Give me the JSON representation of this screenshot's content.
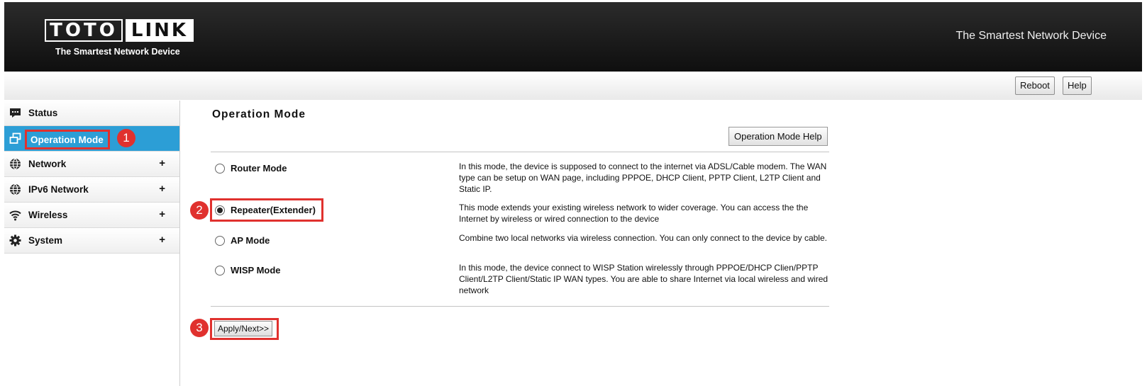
{
  "header": {
    "logo_part1": "TOTO",
    "logo_part2": "LINK",
    "logo_tagline": "The Smartest Network Device",
    "slogan": "The Smartest Network Device"
  },
  "topbar": {
    "reboot_label": "Reboot",
    "help_label": "Help"
  },
  "sidebar": {
    "items": [
      {
        "label": "Status",
        "icon": "chat-icon",
        "expandable": false
      },
      {
        "label": "Operation Mode",
        "icon": "windows-icon",
        "expandable": false,
        "active": true
      },
      {
        "label": "Network",
        "icon": "globe-icon",
        "expandable": true
      },
      {
        "label": "IPv6 Network",
        "icon": "globe-icon",
        "expandable": true
      },
      {
        "label": "Wireless",
        "icon": "wifi-icon",
        "expandable": true
      },
      {
        "label": "System",
        "icon": "gear-icon",
        "expandable": true
      }
    ],
    "expand_symbol": "+"
  },
  "main": {
    "title": "Operation Mode",
    "help_button": "Operation Mode Help",
    "modes": [
      {
        "label": "Router Mode",
        "selected": false,
        "description": "In this mode, the device is supposed to connect to the internet via ADSL/Cable modem. The WAN type can be setup on WAN page, including PPPOE, DHCP Client, PPTP Client, L2TP Client and Static IP."
      },
      {
        "label": "Repeater(Extender)",
        "selected": true,
        "description": "This mode extends your existing wireless network to wider coverage. You can access the the Internet by wireless or wired connection to the device"
      },
      {
        "label": "AP Mode",
        "selected": false,
        "description": "Combine two local networks via wireless connection. You can only connect to the device by cable."
      },
      {
        "label": "WISP Mode",
        "selected": false,
        "description": "In this mode, the device connect to WISP Station wirelessly through PPPOE/DHCP Clien/PPTP Client/L2TP Client/Static IP WAN types. You are able to share Internet via local wireless and wired network"
      }
    ],
    "apply_button": "Apply/Next>>"
  },
  "annotations": {
    "step1": "1",
    "step2": "2",
    "step3": "3",
    "color": "#e0312e"
  },
  "colors": {
    "header_bg": "#1a1a1a",
    "active_nav_bg": "#2c9ed6"
  }
}
